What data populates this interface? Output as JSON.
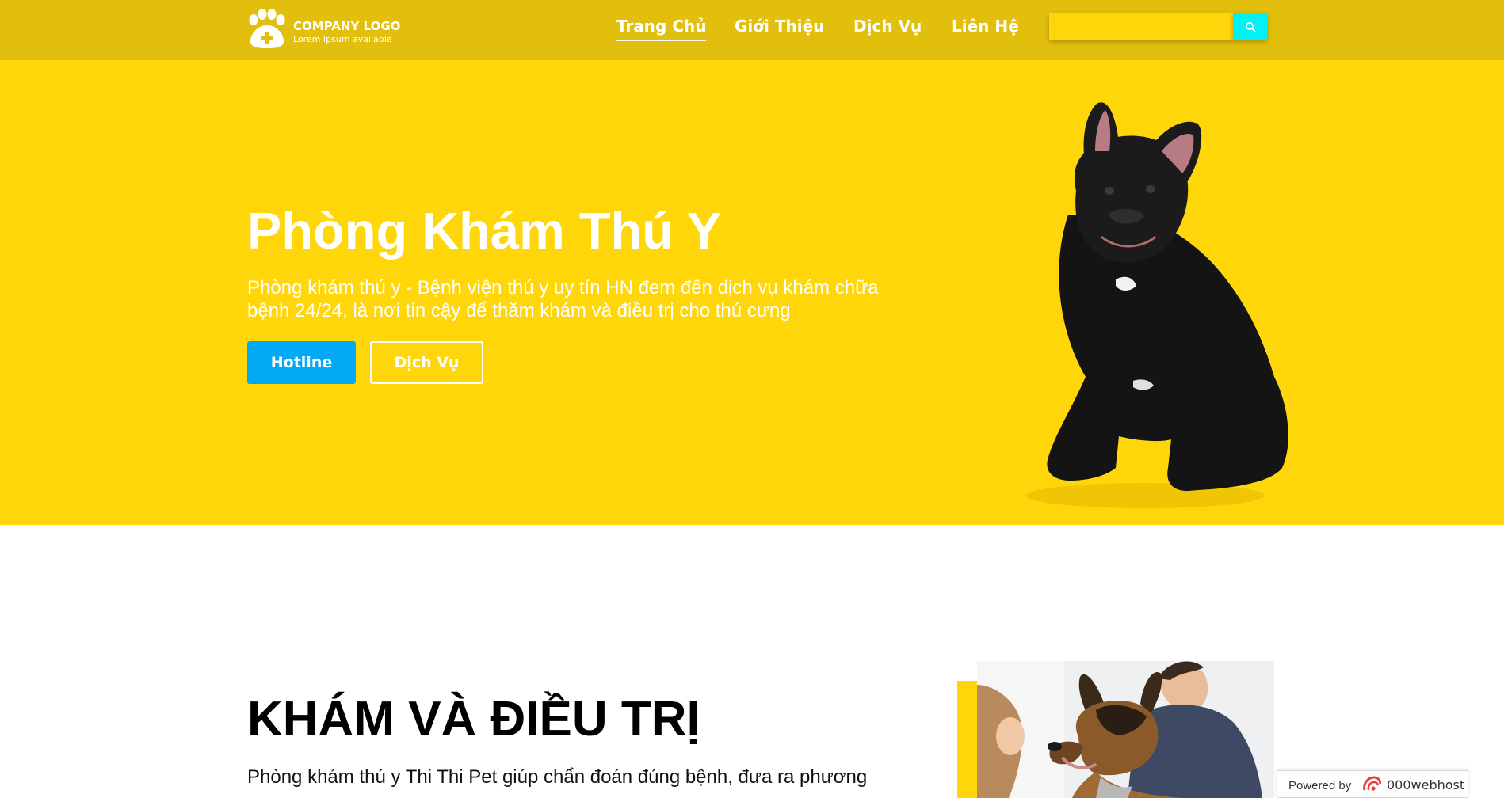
{
  "header": {
    "logo": {
      "title": "COMPANY LOGO",
      "subtitle": "Lorem Ipsum available",
      "icon": "paw-plus-icon"
    },
    "nav": [
      {
        "label": "Trang Chủ",
        "active": true
      },
      {
        "label": "Giới Thiệu",
        "active": false
      },
      {
        "label": "Dịch Vụ",
        "active": false
      },
      {
        "label": "Liên Hệ",
        "active": false
      }
    ],
    "search": {
      "value": "",
      "placeholder": "",
      "button_icon": "search-icon"
    }
  },
  "hero": {
    "title": "Phòng Khám Thú Y",
    "description": "Phòng khám thú y - Bệnh viện thú y uy tín HN đem đến dịch vụ khám chữa bệnh 24/24, là nơi tin cậy để thăm khám và điều trị cho thú cưng",
    "buttons": {
      "hotline": "Hotline",
      "service": "Dịch Vụ"
    },
    "image": "black-french-bulldog-photo"
  },
  "section": {
    "title": "KHÁM VÀ ĐIỀU TRỊ",
    "description": "Phòng khám thú y Thi Thi Pet giúp chẩn đoán đúng bệnh, đưa ra phương",
    "image": "vets-with-german-shepherd-photo"
  },
  "badge": {
    "text": "Powered by",
    "brand": "000webhost"
  },
  "colors": {
    "header_bg": "#e3bf0d",
    "hero_bg": "#ffd60a",
    "search_button": "#00f2f2",
    "hotline_button": "#03a9f4",
    "text_light": "#ffffff"
  }
}
